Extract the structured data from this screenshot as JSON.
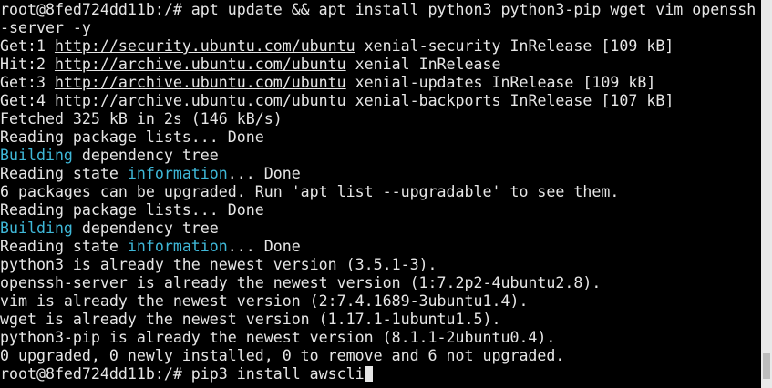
{
  "colors": {
    "background": "#000000",
    "text": "#e6e6e6",
    "highlight": "#3fb8d8",
    "scrollbar_track": "#e9e9e9",
    "scrollbar_thumb": "#bdbdbd"
  },
  "terminal": {
    "lines": [
      [
        {
          "t": "root@8fed724dd11b:/# apt update && apt install python3 python3-pip wget vim openssh"
        }
      ],
      [
        {
          "t": "-server -y"
        }
      ],
      [
        {
          "t": "Get:1 "
        },
        {
          "t": "http://security.ubuntu.com/ubuntu",
          "s": "link"
        },
        {
          "t": " xenial-security InRelease [109 kB]"
        }
      ],
      [
        {
          "t": "Hit:2 "
        },
        {
          "t": "http://archive.ubuntu.com/ubuntu",
          "s": "link"
        },
        {
          "t": " xenial InRelease"
        }
      ],
      [
        {
          "t": "Get:3 "
        },
        {
          "t": "http://archive.ubuntu.com/ubuntu",
          "s": "link"
        },
        {
          "t": " xenial-updates InRelease [109 kB]"
        }
      ],
      [
        {
          "t": "Get:4 "
        },
        {
          "t": "http://archive.ubuntu.com/ubuntu",
          "s": "link"
        },
        {
          "t": " xenial-backports InRelease [107 kB]"
        }
      ],
      [
        {
          "t": "Fetched 325 kB in 2s (146 kB/s)"
        }
      ],
      [
        {
          "t": "Reading package lists... Done"
        }
      ],
      [
        {
          "t": "Building",
          "s": "cyan"
        },
        {
          "t": " dependency tree"
        }
      ],
      [
        {
          "t": "Reading state "
        },
        {
          "t": "information",
          "s": "cyan"
        },
        {
          "t": "... Done"
        }
      ],
      [
        {
          "t": "6 packages can be upgraded. Run 'apt list --upgradable' to see them."
        }
      ],
      [
        {
          "t": "Reading package lists... Done"
        }
      ],
      [
        {
          "t": "Building",
          "s": "cyan"
        },
        {
          "t": " dependency tree"
        }
      ],
      [
        {
          "t": "Reading state "
        },
        {
          "t": "information",
          "s": "cyan"
        },
        {
          "t": "... Done"
        }
      ],
      [
        {
          "t": "python3 is already the newest version (3.5.1-3)."
        }
      ],
      [
        {
          "t": "openssh-server is already the newest version (1:7.2p2-4ubuntu2.8)."
        }
      ],
      [
        {
          "t": "vim is already the newest version (2:7.4.1689-3ubuntu1.4)."
        }
      ],
      [
        {
          "t": "wget is already the newest version (1.17.1-1ubuntu1.5)."
        }
      ],
      [
        {
          "t": "python3-pip is already the newest version (8.1.1-2ubuntu0.4)."
        }
      ],
      [
        {
          "t": "0 upgraded, 0 newly installed, 0 to remove and 6 not upgraded."
        }
      ],
      [
        {
          "t": "root@8fed724dd11b:/# pip3 install awscli"
        },
        {
          "cursor": true
        }
      ]
    ]
  }
}
